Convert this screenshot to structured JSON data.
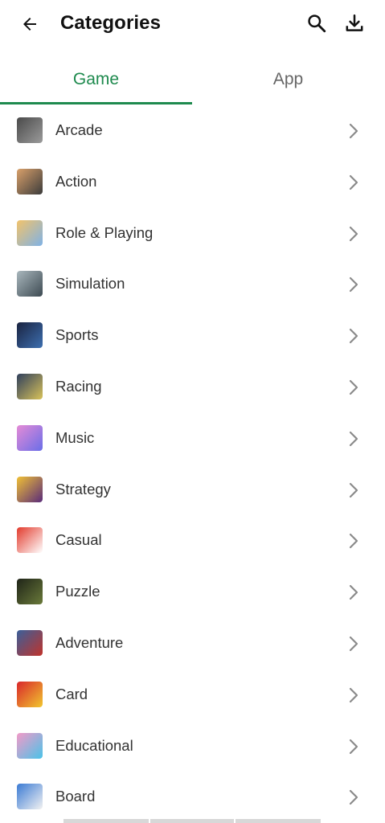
{
  "header": {
    "title": "Categories"
  },
  "icons": {
    "back": "back-arrow-icon",
    "search": "search-icon",
    "download": "download-icon",
    "chevron": "chevron-right-icon"
  },
  "tabs": [
    {
      "label": "Game",
      "active": true
    },
    {
      "label": "App",
      "active": false
    }
  ],
  "colors": {
    "accent": "#1e8a4e",
    "inactive_tab": "#666666"
  },
  "categories": [
    {
      "label": "Arcade",
      "thumb": [
        "#4a4a4a",
        "#9b9b9b"
      ]
    },
    {
      "label": "Action",
      "thumb": [
        "#d9a06a",
        "#3b3b3b"
      ]
    },
    {
      "label": "Role & Playing",
      "thumb": [
        "#f2c36b",
        "#7fb2e6"
      ]
    },
    {
      "label": "Simulation",
      "thumb": [
        "#a9b7bd",
        "#3d4a52"
      ]
    },
    {
      "label": "Sports",
      "thumb": [
        "#1a2340",
        "#3d6fb0"
      ]
    },
    {
      "label": "Racing",
      "thumb": [
        "#2f3f5c",
        "#d8c25a"
      ]
    },
    {
      "label": "Music",
      "thumb": [
        "#e58bd6",
        "#6a6ee8"
      ]
    },
    {
      "label": "Strategy",
      "thumb": [
        "#f0c035",
        "#5a2b7a"
      ]
    },
    {
      "label": "Casual",
      "thumb": [
        "#e23a2c",
        "#ffffff"
      ]
    },
    {
      "label": "Puzzle",
      "thumb": [
        "#1f2418",
        "#6a7a3a"
      ]
    },
    {
      "label": "Adventure",
      "thumb": [
        "#3a5f9a",
        "#c0332b"
      ]
    },
    {
      "label": "Card",
      "thumb": [
        "#d9262b",
        "#f1c62f"
      ]
    },
    {
      "label": "Educational",
      "thumb": [
        "#f39ac8",
        "#4ac3e8"
      ]
    },
    {
      "label": "Board",
      "thumb": [
        "#3b7bd4",
        "#f2f2f2"
      ]
    }
  ]
}
